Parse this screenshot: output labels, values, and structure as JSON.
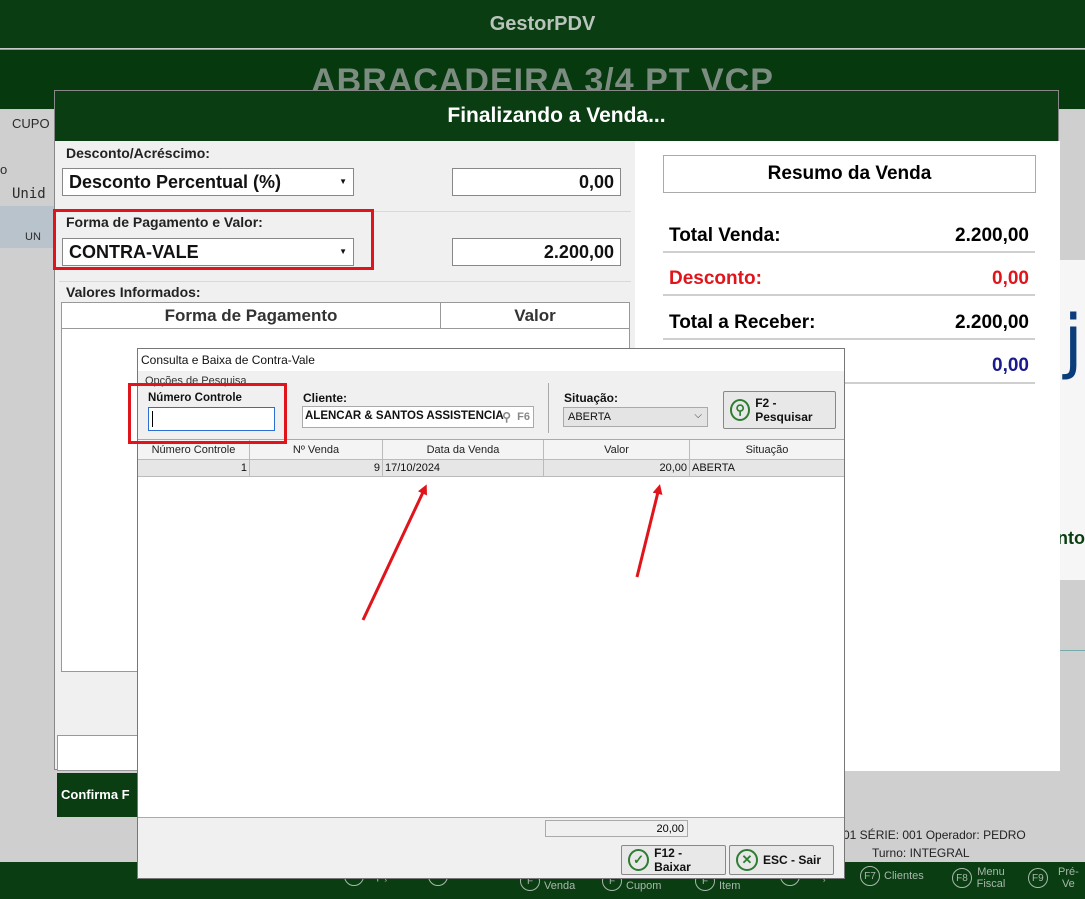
{
  "app": {
    "title": "GestorPDV",
    "product": "ABRACADEIRA 3/4 PT VCP",
    "bg_cupom": "CUPO",
    "bg_o": "o",
    "bg_unid": "Unid",
    "bg_un": "UN",
    "status_line1": "01  SÉRIE: 001  Operador: PEDRO",
    "status_line2": "Turno: INTEGRAL",
    "bg_glyph": "j",
    "bg_nto": "nto",
    "footer_keys": [
      {
        "key": "F",
        "label": "Opções"
      },
      {
        "key": "F",
        "label": "Produtos"
      },
      {
        "key": "F",
        "label": "Venda"
      },
      {
        "key": "F",
        "label": "Cupom"
      },
      {
        "key": "F",
        "label": "Item"
      },
      {
        "key": "F",
        "label": "Preço"
      },
      {
        "key": "F7",
        "label": "Clientes"
      },
      {
        "key": "F8",
        "label": "Menu Fiscal"
      },
      {
        "key": "F9",
        "label": "Pré-Ve"
      }
    ]
  },
  "finalizando": {
    "title": "Finalizando a Venda...",
    "desconto_label": "Desconto/Acréscimo:",
    "desconto_tipo": "Desconto Percentual (%)",
    "desconto_valor": "0,00",
    "forma_label": "Forma de Pagamento e Valor:",
    "forma_tipo": "CONTRA-VALE",
    "forma_valor": "2.200,00",
    "valores_label": "Valores Informados:",
    "grid_headers": [
      "Forma de Pagamento",
      "Valor"
    ],
    "confirm_label": "Confirma F",
    "resumo": {
      "title": "Resumo da Venda",
      "total_venda_label": "Total Venda:",
      "total_venda": "2.200,00",
      "desconto_label": "Desconto:",
      "desconto": "0,00",
      "total_receber_label": "Total a Receber:",
      "total_receber": "2.200,00",
      "troco": "0,00"
    }
  },
  "contravale": {
    "title": "Consulta e Baixa de Contra-Vale",
    "opcoes": "Opções de Pesquisa",
    "numero_label": "Número Controle",
    "numero_value": "",
    "cliente_label": "Cliente:",
    "cliente_value": "ALENCAR & SANTOS ASSISTENCIA",
    "cliente_key": "F6",
    "situacao_label": "Situação:",
    "situacao_value": "ABERTA",
    "pesquisar": "F2 - Pesquisar",
    "headers": [
      "Número Controle",
      "Nº Venda",
      "Data da Venda",
      "Valor",
      "Situação"
    ],
    "rows": [
      {
        "numero": "1",
        "venda": "9",
        "data": "17/10/2024",
        "valor": "20,00",
        "situacao": "ABERTA"
      }
    ],
    "total": "20,00",
    "baixar": "F12 - Baixar",
    "sair": "ESC - Sair"
  },
  "colors": {
    "dark_green": "#0a3d12",
    "highlight_red": "#e0141b",
    "desconto_red": "#e0141b",
    "troco_blue": "#1a1a8c"
  }
}
